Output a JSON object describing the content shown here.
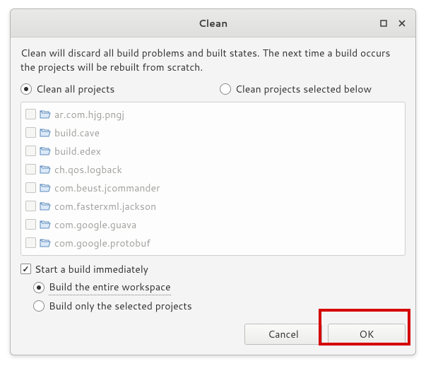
{
  "title": "Clean",
  "description": "Clean will discard all build problems and built states.  The next time a build occurs the projects will be rebuilt from scratch.",
  "scope": {
    "all_label": "Clean all projects",
    "selected_label": "Clean projects selected below"
  },
  "projects": [
    "ar.com.hjg.pngj",
    "build.cave",
    "build.edex",
    "ch.qos.logback",
    "com.beust.jcommander",
    "com.fasterxml.jackson",
    "com.google.guava",
    "com.google.protobuf"
  ],
  "start_build_label": "Start a build immediately",
  "build_scope": {
    "entire_label": "Build the entire workspace",
    "selected_label": "Build only the selected projects"
  },
  "buttons": {
    "cancel": "Cancel",
    "ok": "OK"
  }
}
